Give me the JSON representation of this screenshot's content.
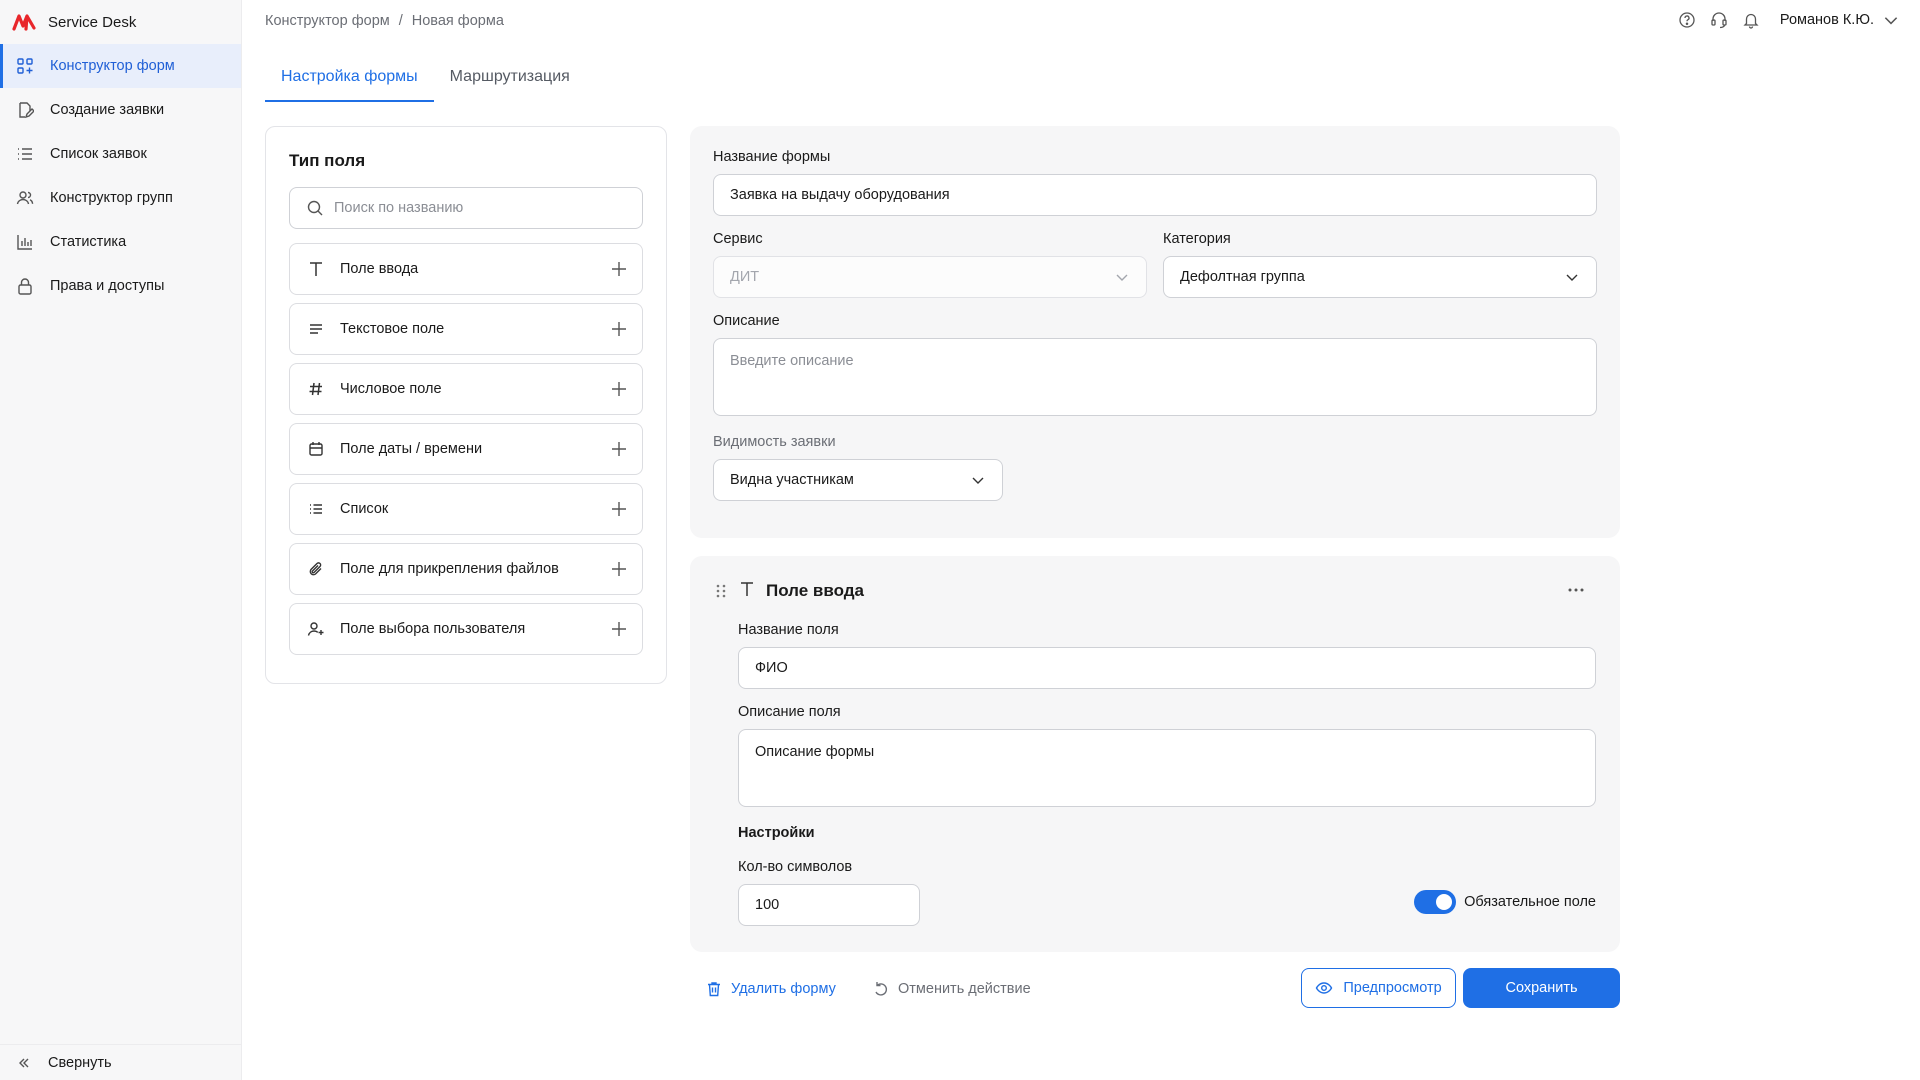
{
  "app": {
    "name": "Service Desk",
    "accent": "#1f6fe5",
    "logo_color": "#e8262b"
  },
  "sidebar": {
    "items": [
      {
        "label": "Конструктор форм",
        "icon": "form-builder-icon",
        "active": true
      },
      {
        "label": "Создание заявки",
        "icon": "create-request-icon"
      },
      {
        "label": "Список заявок",
        "icon": "list-icon"
      },
      {
        "label": "Конструктор групп",
        "icon": "group-icon"
      },
      {
        "label": "Статистика",
        "icon": "chart-icon"
      },
      {
        "label": "Права и доступы",
        "icon": "lock-icon"
      }
    ],
    "collapse_label": "Свернуть"
  },
  "header": {
    "breadcrumb": [
      "Конструктор форм",
      "Новая форма"
    ],
    "user": "Романов К.Ю."
  },
  "tabs": [
    {
      "label": "Настройка формы",
      "active": true
    },
    {
      "label": "Маршрутизация"
    }
  ],
  "field_types": {
    "title": "Тип поля",
    "search_placeholder": "Поиск по названию",
    "items": [
      {
        "label": "Поле ввода",
        "icon": "text-t-icon"
      },
      {
        "label": "Текстовое поле",
        "icon": "text-lines-icon"
      },
      {
        "label": "Числовое поле",
        "icon": "hash-icon"
      },
      {
        "label": "Поле даты / времени",
        "icon": "calendar-icon"
      },
      {
        "label": "Список",
        "icon": "list-icon"
      },
      {
        "label": "Поле для прикрепления файлов",
        "icon": "paperclip-icon"
      },
      {
        "label": "Поле выбора пользователя",
        "icon": "user-add-icon"
      }
    ]
  },
  "form": {
    "name_label": "Название формы",
    "name_value": "Заявка на выдачу оборудования",
    "service_label": "Сервис",
    "service_value": "ДИТ",
    "category_label": "Категория",
    "category_value": "Дефолтная группа",
    "description_label": "Описание",
    "description_placeholder": "Введите описание",
    "visibility_label": "Видимость заявки",
    "visibility_value": "Видна участникам"
  },
  "field_card": {
    "title": "Поле ввода",
    "name_label": "Название поля",
    "name_value": "ФИО",
    "desc_label": "Описание поля",
    "desc_value": "Описание формы",
    "settings_title": "Настройки",
    "count_label": "Кол-во символов",
    "count_value": "100",
    "required_label": "Обязательное поле",
    "required_on": true
  },
  "actions": {
    "delete_label": "Удалить форму",
    "undo_label": "Отменить действие",
    "preview_label": "Предпросмотр",
    "save_label": "Сохранить"
  }
}
